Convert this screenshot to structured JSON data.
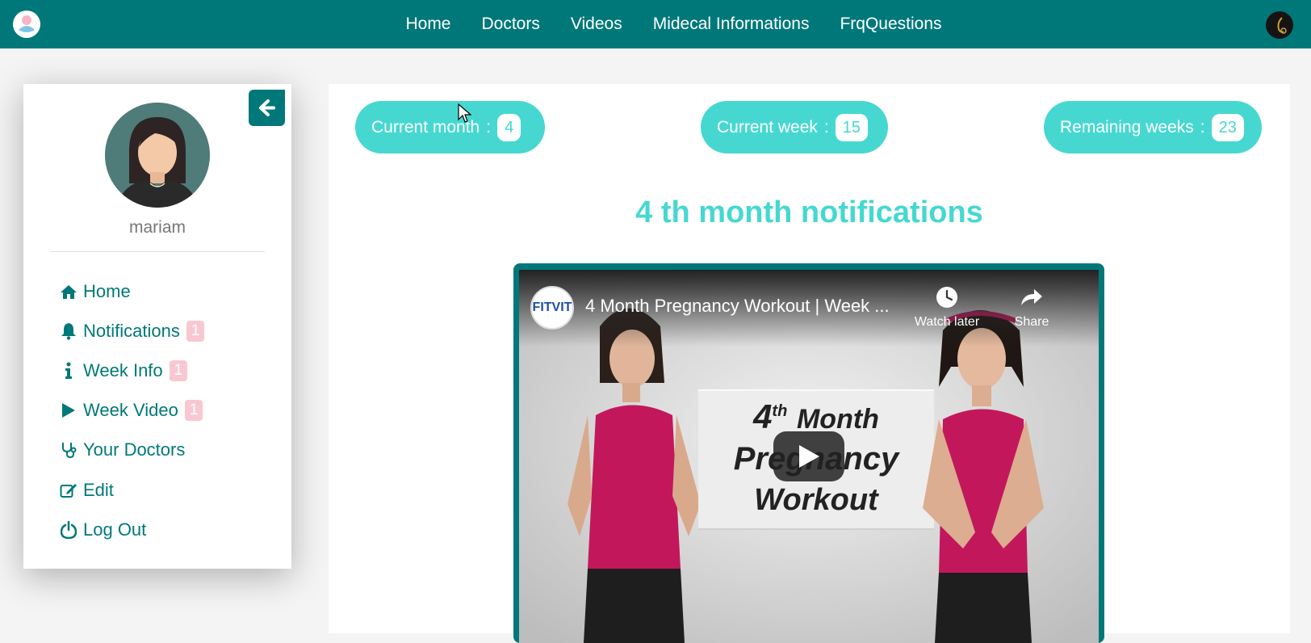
{
  "navbar": {
    "links": [
      "Home",
      "Doctors",
      "Videos",
      "Midecal Informations",
      "FrqQuestions"
    ]
  },
  "sidebar": {
    "username": "mariam",
    "items": [
      {
        "label": "Home",
        "icon": "home-icon"
      },
      {
        "label": "Notifications",
        "icon": "bell-icon",
        "badge": "1"
      },
      {
        "label": "Week Info",
        "icon": "info-icon",
        "badge": "1"
      },
      {
        "label": "Week Video",
        "icon": "play-icon",
        "badge": "1"
      },
      {
        "label": "Your Doctors",
        "icon": "stethoscope-icon"
      },
      {
        "label": "Edit",
        "icon": "edit-icon"
      },
      {
        "label": "Log Out",
        "icon": "power-icon"
      }
    ]
  },
  "stats": {
    "current_month_label": "Current month",
    "current_month_value": "4",
    "current_week_label": "Current week",
    "current_week_value": "15",
    "remaining_weeks_label": "Remaining weeks",
    "remaining_weeks_value": "23",
    "separator": ":"
  },
  "main": {
    "notifications_title": "4 th month notifications"
  },
  "video": {
    "channel": "FITVIT",
    "title": "4 Month Pregnancy Workout | Week ...",
    "watch_later": "Watch later",
    "share": "Share",
    "thumb_number": "4",
    "thumb_sup": "th",
    "thumb_word1": "Month",
    "thumb_word2": "Pregnancy",
    "thumb_word3": "Workout"
  },
  "colors": {
    "primary": "#00787a",
    "accent": "#46d8d0",
    "badge": "#f8c8d2"
  }
}
